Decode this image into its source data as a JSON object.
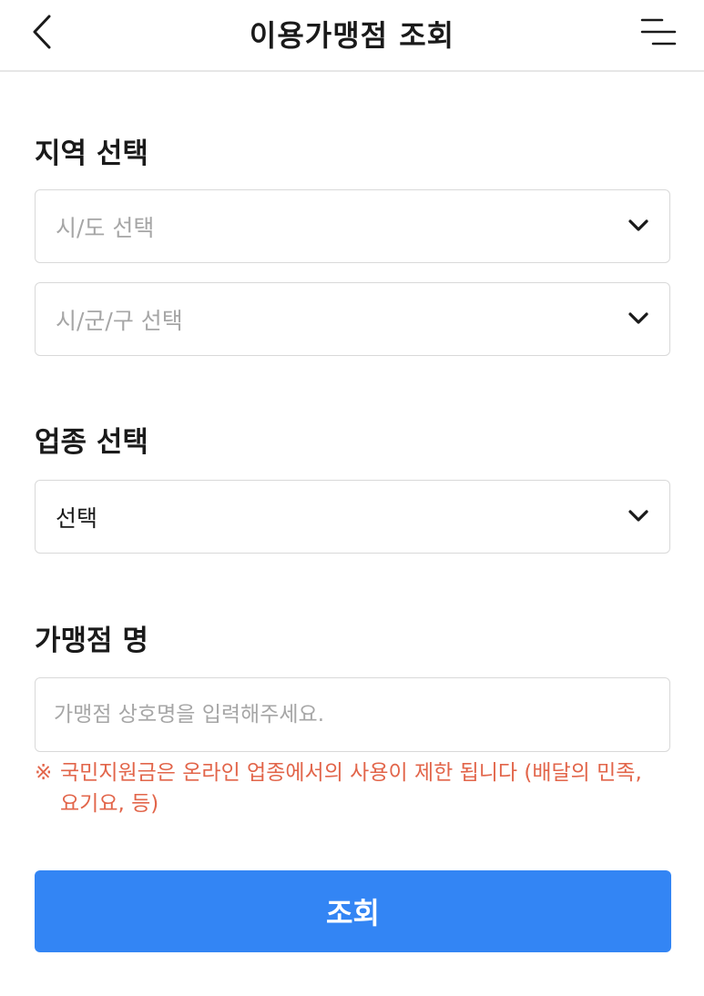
{
  "header": {
    "title": "이용가맹점 조회",
    "back_icon": "chevron-left-icon",
    "menu_icon": "menu-lines-icon"
  },
  "region": {
    "label": "지역 선택",
    "province_placeholder": "시/도 선택",
    "district_placeholder": "시/군/구 선택"
  },
  "industry": {
    "label": "업종 선택",
    "selected_value": "선택"
  },
  "merchant": {
    "label": "가맹점 명",
    "placeholder": "가맹점 상호명을 입력해주세요.",
    "value": ""
  },
  "notice": {
    "mark": "※",
    "line1": "국민지원금은 온라인 업종에서의 사용이 제한 됩니다 (배달의 민족,",
    "line2": "요기요, 등)"
  },
  "submit": {
    "label": "조회"
  },
  "colors": {
    "accent": "#3385f4",
    "warning": "#e2654a",
    "placeholder": "#a6a6a6",
    "border": "#d9d9d9"
  }
}
